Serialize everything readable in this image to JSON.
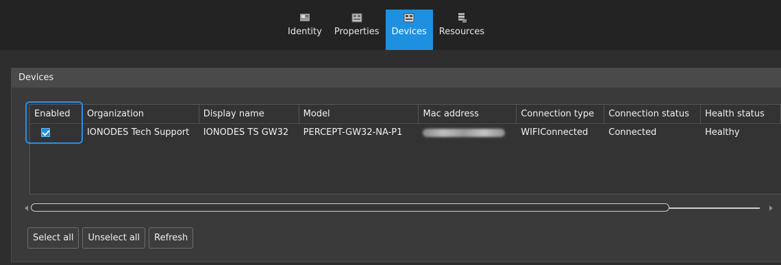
{
  "tabs": [
    {
      "label": "Identity",
      "icon": "identity-icon",
      "active": false
    },
    {
      "label": "Properties",
      "icon": "properties-icon",
      "active": false
    },
    {
      "label": "Devices",
      "icon": "devices-icon",
      "active": true
    },
    {
      "label": "Resources",
      "icon": "resources-icon",
      "active": false
    }
  ],
  "group": {
    "title": "Devices"
  },
  "table": {
    "columns": [
      "Enabled",
      "Organization",
      "Display name",
      "Model",
      "Mac address",
      "Connection type",
      "Connection status",
      "Health status"
    ],
    "rows": [
      {
        "enabled": true,
        "organization": "IONODES Tech Support",
        "display_name": "IONODES TS GW32",
        "model": "PERCEPT-GW32-NA-P1",
        "mac_address": "",
        "connection_type": "WIFIConnected",
        "connection_status": "Connected",
        "health_status": "Healthy"
      }
    ]
  },
  "buttons": {
    "select_all": "Select all",
    "unselect_all": "Unselect all",
    "refresh": "Refresh"
  },
  "colors": {
    "accent": "#1e90e0",
    "background": "#2b2b2b",
    "panel": "#3a3a3a"
  }
}
